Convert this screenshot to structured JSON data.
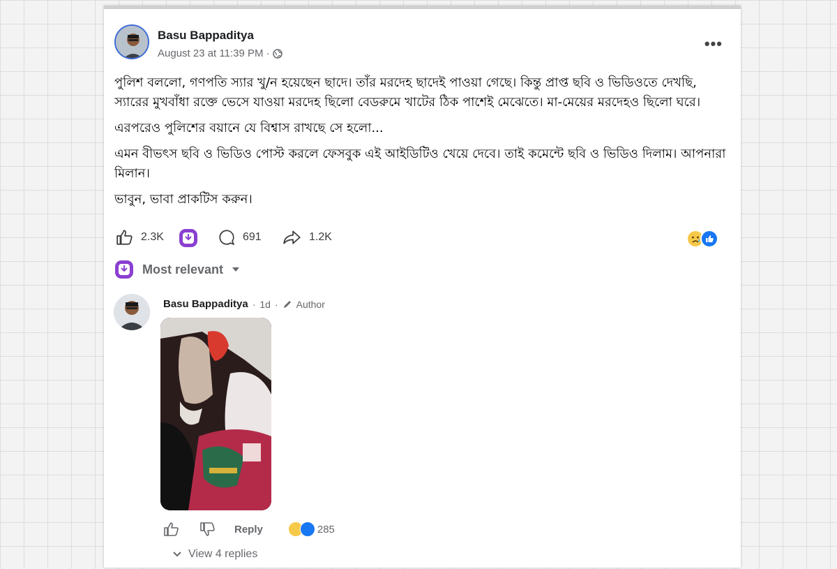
{
  "post": {
    "author": "Basu Bappaditya",
    "timestamp": "August 23 at 11:39 PM",
    "privacy_separator": "·",
    "privacy_icon": "globe-icon",
    "menu_label": "•••",
    "paragraphs": [
      "পুলিশ বললো, গণপতি স্যার খু/ন হয়েছেন ছাদে। তাঁর মরদেহ ছাদেই পাওয়া গেছে। কিন্তু প্রাপ্ত ছবি ও ভিডিওতে দেখছি, স্যারের মুখবাঁধা রক্তে ভেসে যাওয়া মরদেহ ছিলো বেডরুমে খাটের ঠিক পাশেই মেঝেতে। মা-মেয়ের মরদেহও ছিলো ঘরে।",
      "এরপরেও পুলিশের বয়ানে যে বিশ্বাস রাখছে সে হলো...",
      "এমন বীভৎস ছবি ও ভিডিও পোস্ট করলে ফেসবুক এই আইডিটিও খেয়ে দেবে। তাই কমেন্টে ছবি ও ভিডিও দিলাম। আপনারা মিলান।",
      "ভাবুন, ভাবা প্রাকটিস করুন।"
    ],
    "stats": {
      "likes": "2.3K",
      "comments": "691",
      "shares": "1.2K"
    }
  },
  "sort": {
    "label": "Most relevant"
  },
  "comment": {
    "author": "Basu Bappaditya",
    "time": "1d",
    "separator": "·",
    "badge": "Author",
    "reply_label": "Reply",
    "reaction_count": "285",
    "view_replies": "View 4 replies"
  },
  "colors": {
    "accent": "#1877f2",
    "purple_badge": "#8a3fd1",
    "muted": "#65676b"
  }
}
